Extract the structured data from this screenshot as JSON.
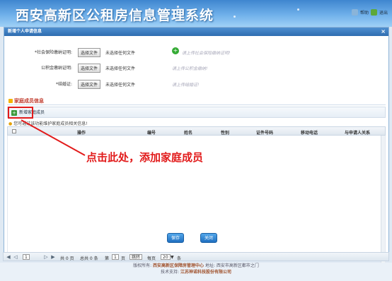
{
  "header": {
    "title": "西安高新区公租房信息管理系统",
    "help_label": "帮助",
    "logout_label": "退出"
  },
  "panel": {
    "title": "新增个人申请信息",
    "close": "×"
  },
  "form": {
    "rows": [
      {
        "label": "*社会保险缴纳证明:",
        "button": "选择文件",
        "file_status": "未选择任何文件",
        "hint": "请上传社会保险缴纳证明!"
      },
      {
        "label": "公积金缴纳证明:",
        "button": "选择文件",
        "file_status": "未选择任何文件",
        "hint": "请上传公积金缴纳!"
      },
      {
        "label": "*结婚证:",
        "button": "选择文件",
        "file_status": "未选择任何文件",
        "hint": "请上传结婚证!"
      }
    ]
  },
  "family": {
    "section_title": "家庭成员信息",
    "add_button": "新增家庭成员",
    "notice": "您可通过该功能维护家庭成员相关信息!",
    "columns": [
      "操作",
      "编号",
      "姓名",
      "性别",
      "证件号码",
      "移动电话",
      "与申请人关系"
    ]
  },
  "annotation": {
    "callout": "点击此处，添加家庭成员"
  },
  "actions": {
    "save_label": "保存",
    "close_label": "关闭"
  },
  "pager": {
    "current_page": "1",
    "page_text": "共 0 页",
    "total_text": "总共 0 条",
    "jump_prefix": "第",
    "jump_page": "1",
    "jump_suffix": "页",
    "jump_button": "跳转",
    "per_page_prefix": "每页",
    "per_page": "20",
    "per_page_suffix": "条"
  },
  "footer": {
    "line1_prefix": "版权所有:",
    "line1_org": "西安高新区保障房管理中心",
    "line1_addr": "地址: 西安市高新区都市之门",
    "line2_prefix": "技术支持:",
    "line2_org": "江苏神诺科技股份有限公司"
  }
}
